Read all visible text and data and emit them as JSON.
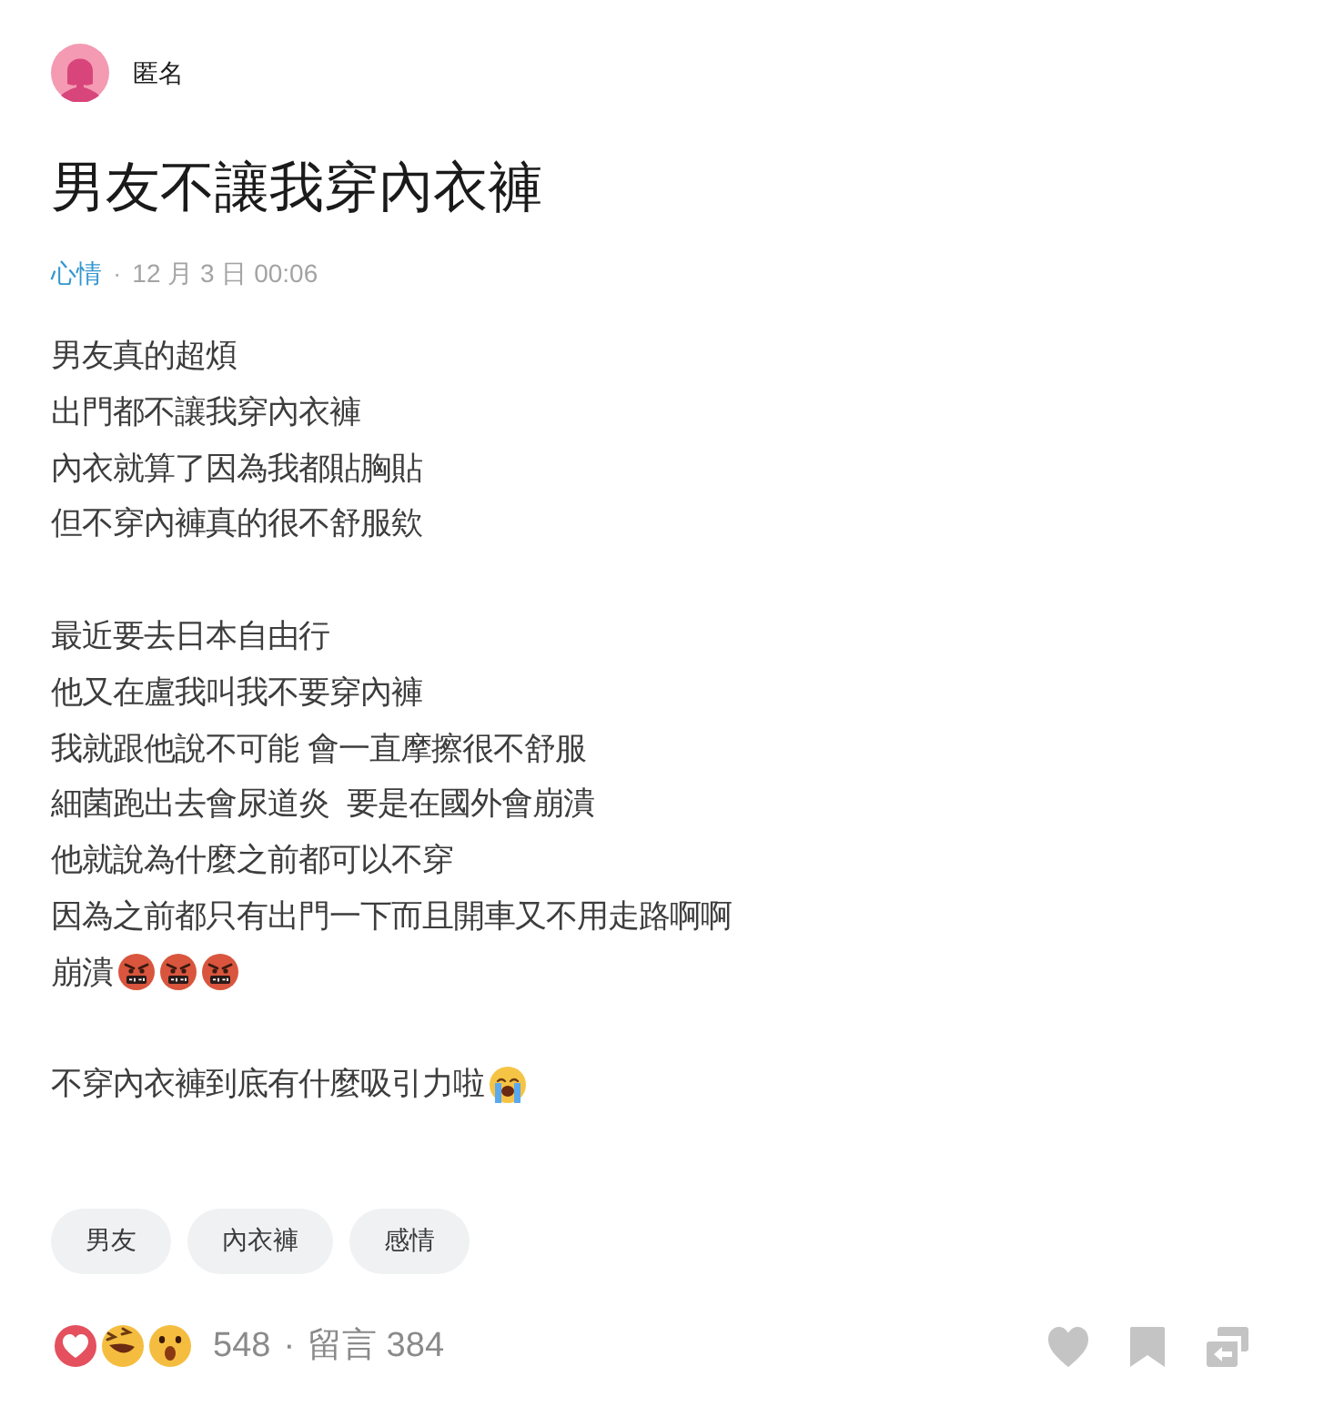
{
  "author": {
    "name": "匿名"
  },
  "post": {
    "title": "男友不讓我穿內衣褲",
    "meta": {
      "category": "心情",
      "separator": "·",
      "date": "12 月 3 日 00:06"
    },
    "paragraphs": [
      {
        "lines": [
          {
            "text": "男友真的超煩"
          },
          {
            "text": "出門都不讓我穿內衣褲"
          },
          {
            "text": "內衣就算了因為我都貼胸貼"
          },
          {
            "text": "但不穿內褲真的很不舒服欸"
          }
        ]
      },
      {
        "lines": [
          {
            "text": "最近要去日本自由行"
          },
          {
            "text": "他又在盧我叫我不要穿內褲"
          },
          {
            "text": "我就跟他說不可能 會一直摩擦很不舒服"
          },
          {
            "text": "細菌跑出去會尿道炎  要是在國外會崩潰"
          },
          {
            "text": "他就說為什麼之前都可以不穿"
          },
          {
            "text": "因為之前都只有出門一下而且開車又不用走路啊啊"
          },
          {
            "text": "崩潰",
            "emojis": [
              {
                "kind": "angry"
              },
              {
                "kind": "angry"
              },
              {
                "kind": "angry"
              }
            ]
          }
        ]
      },
      {
        "lines": [
          {
            "text": "不穿內衣褲到底有什麼吸引力啦",
            "emojis": [
              {
                "kind": "crying"
              }
            ]
          }
        ]
      }
    ]
  },
  "tags": [
    {
      "label": "男友"
    },
    {
      "label": "內衣褲"
    },
    {
      "label": "感情"
    }
  ],
  "footer": {
    "reactions": [
      {
        "kind": "love"
      },
      {
        "kind": "haha"
      },
      {
        "kind": "wow"
      }
    ],
    "reaction_count": "548",
    "separator": "·",
    "comments": "留言 384",
    "actions": [
      {
        "kind": "like"
      },
      {
        "kind": "bookmark"
      },
      {
        "kind": "share"
      }
    ]
  }
}
